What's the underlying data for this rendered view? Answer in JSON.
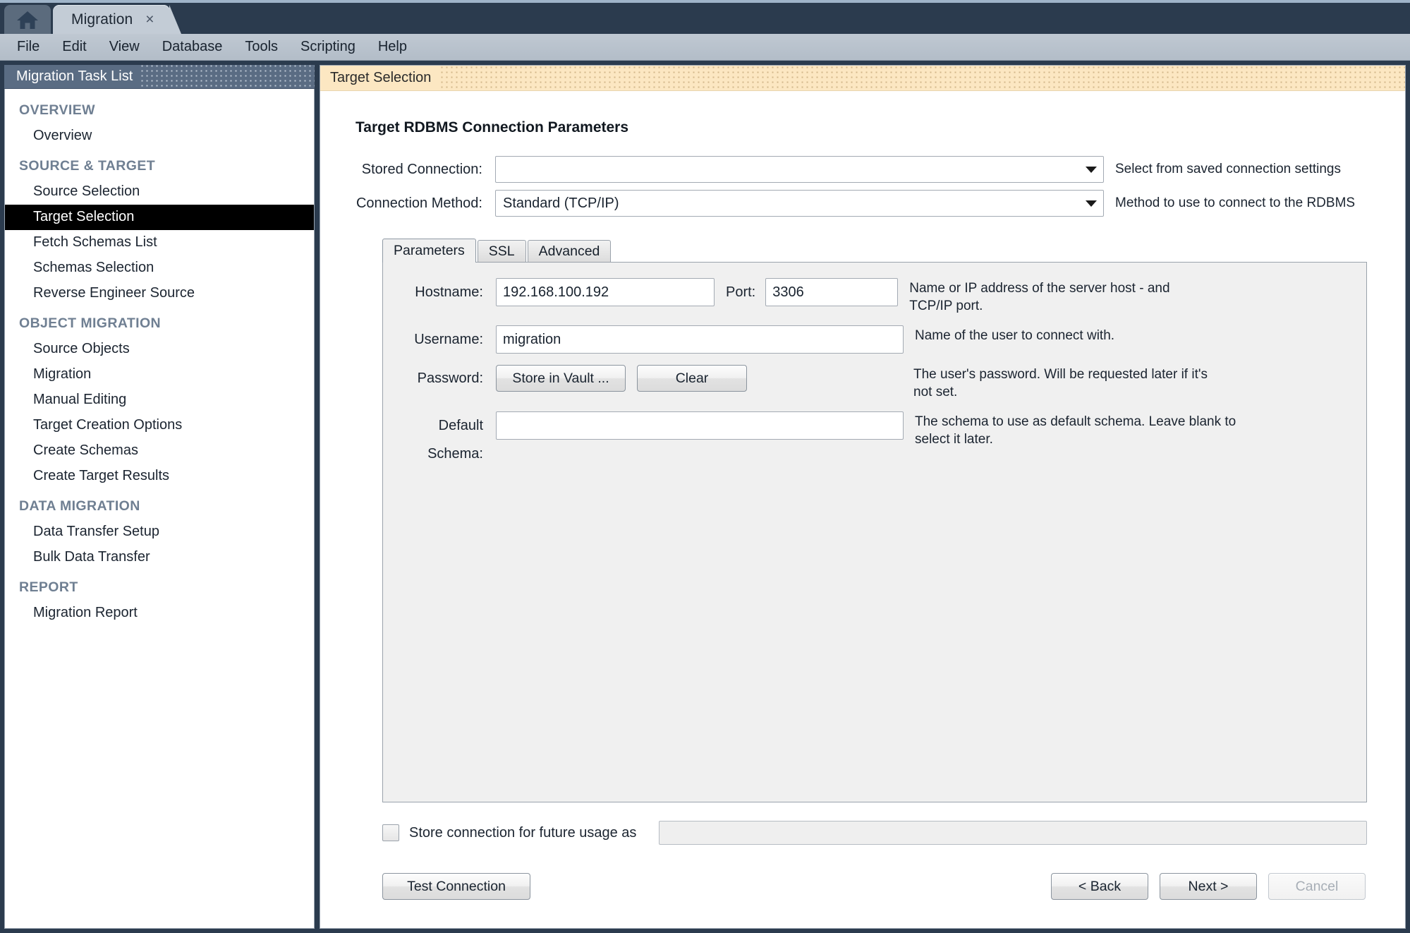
{
  "window": {
    "home_tab_icon": "home-icon",
    "document_tab": {
      "label": "Migration",
      "close": "×"
    }
  },
  "menubar": {
    "items": [
      "File",
      "Edit",
      "View",
      "Database",
      "Tools",
      "Scripting",
      "Help"
    ]
  },
  "sidebar": {
    "header": "Migration Task List",
    "groups": [
      {
        "title": "OVERVIEW",
        "items": [
          {
            "label": "Overview",
            "active": false
          }
        ]
      },
      {
        "title": "SOURCE & TARGET",
        "items": [
          {
            "label": "Source Selection",
            "active": false
          },
          {
            "label": "Target Selection",
            "active": true
          },
          {
            "label": "Fetch Schemas List",
            "active": false
          },
          {
            "label": "Schemas Selection",
            "active": false
          },
          {
            "label": "Reverse Engineer Source",
            "active": false
          }
        ]
      },
      {
        "title": "OBJECT MIGRATION",
        "items": [
          {
            "label": "Source Objects",
            "active": false
          },
          {
            "label": "Migration",
            "active": false
          },
          {
            "label": "Manual Editing",
            "active": false
          },
          {
            "label": "Target Creation Options",
            "active": false
          },
          {
            "label": "Create Schemas",
            "active": false
          },
          {
            "label": "Create Target Results",
            "active": false
          }
        ]
      },
      {
        "title": "DATA MIGRATION",
        "items": [
          {
            "label": "Data Transfer Setup",
            "active": false
          },
          {
            "label": "Bulk Data Transfer",
            "active": false
          }
        ]
      },
      {
        "title": "REPORT",
        "items": [
          {
            "label": "Migration Report",
            "active": false
          }
        ]
      }
    ]
  },
  "content": {
    "header_title": "Target Selection",
    "page_title": "Target RDBMS Connection Parameters",
    "stored_connection": {
      "label": "Stored Connection:",
      "value": "",
      "hint": "Select from saved connection settings"
    },
    "connection_method": {
      "label": "Connection Method:",
      "value": "Standard (TCP/IP)",
      "hint": "Method to use to connect to the RDBMS"
    },
    "tabs": [
      {
        "label": "Parameters",
        "active": true
      },
      {
        "label": "SSL",
        "active": false
      },
      {
        "label": "Advanced",
        "active": false
      }
    ],
    "parameters": {
      "hostname": {
        "label": "Hostname:",
        "value": "192.168.100.192"
      },
      "port": {
        "label": "Port:",
        "value": "3306"
      },
      "host_hint": "Name or IP address of the server host - and TCP/IP port.",
      "username": {
        "label": "Username:",
        "value": "migration"
      },
      "username_hint": "Name of the user to connect with.",
      "password": {
        "label": "Password:",
        "store_button": "Store in Vault ...",
        "clear_button": "Clear",
        "hint": "The user's password. Will be requested later if it's not set."
      },
      "default_schema": {
        "label": "Default Schema:",
        "value": "",
        "hint": "The schema to use as default schema. Leave blank to select it later."
      }
    },
    "store_connection": {
      "checked": false,
      "label": "Store connection for future usage as",
      "value": ""
    },
    "footer": {
      "test_connection": "Test Connection",
      "back": "< Back",
      "next": "Next >",
      "cancel": "Cancel",
      "cancel_disabled": true
    }
  },
  "colors": {
    "window_frame": "#2b3b4e",
    "sidebar_header": "#5a6c83",
    "content_header": "#fce7c2",
    "active_item_bg": "#000000",
    "group_title": "#6f7f92"
  }
}
